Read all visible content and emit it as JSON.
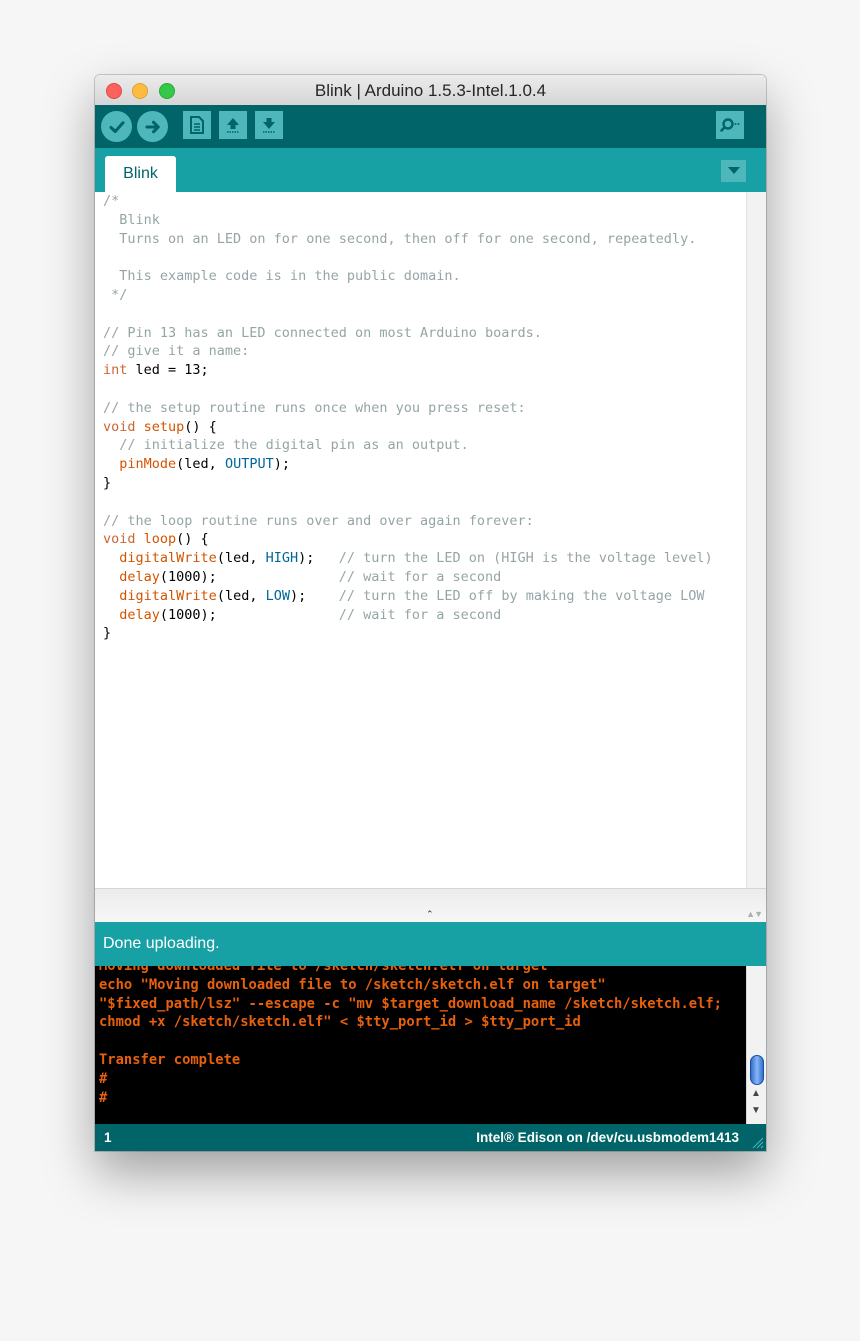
{
  "window": {
    "title": "Blink | Arduino 1.5.3-Intel.1.0.4"
  },
  "toolbar": {
    "buttons": [
      {
        "icon": "check-icon",
        "tooltip": ""
      },
      {
        "icon": "arrow-right-icon",
        "tooltip": ""
      },
      {
        "icon": "new-document-icon",
        "tooltip": ""
      },
      {
        "icon": "upload-arrow-icon",
        "tooltip": ""
      },
      {
        "icon": "download-arrow-icon",
        "tooltip": ""
      },
      {
        "icon": "serial-monitor-icon",
        "tooltip": ""
      }
    ]
  },
  "tabs": [
    {
      "label": "Blink",
      "active": true
    }
  ],
  "editor": {
    "lines": [
      "/*",
      "  Blink",
      "  Turns on an LED on for one second, then off for one second, repeatedly.",
      "",
      "  This example code is in the public domain.",
      " */",
      "",
      "// Pin 13 has an LED connected on most Arduino boards.",
      "// give it a name:",
      "int led = 13;",
      "",
      "// the setup routine runs once when you press reset:",
      "void setup() {",
      "  // initialize the digital pin as an output.",
      "  pinMode(led, OUTPUT);",
      "}",
      "",
      "// the loop routine runs over and over again forever:",
      "void loop() {",
      "  digitalWrite(led, HIGH);   // turn the LED on (HIGH is the voltage level)",
      "  delay(1000);               // wait for a second",
      "  digitalWrite(led, LOW);    // turn the LED off by making the voltage LOW",
      "  delay(1000);               // wait for a second",
      "}"
    ]
  },
  "status": {
    "message": "Done uploading."
  },
  "console": {
    "lines": [
      "Moving downloaded file to /sketch/sketch.elf on target",
      "echo \"Moving downloaded file to /sketch/sketch.elf on target\"",
      "\"$fixed_path/lsz\" --escape -c \"mv $target_download_name /sketch/sketch.elf;",
      "chmod +x /sketch/sketch.elf\" < $tty_port_id > $tty_port_id",
      "",
      "Transfer complete",
      "#",
      "#"
    ]
  },
  "footer": {
    "line_number": "1",
    "board": "Intel® Edison on /dev/cu.usbmodem1413"
  },
  "colors": {
    "toolbar_bg": "#006468",
    "tabbar_bg": "#17a1a5",
    "button_bg": "#4db7bb",
    "console_text": "#e8600c",
    "comment": "#95a5a6",
    "keyword": "#cc6633",
    "constant": "#006699"
  }
}
